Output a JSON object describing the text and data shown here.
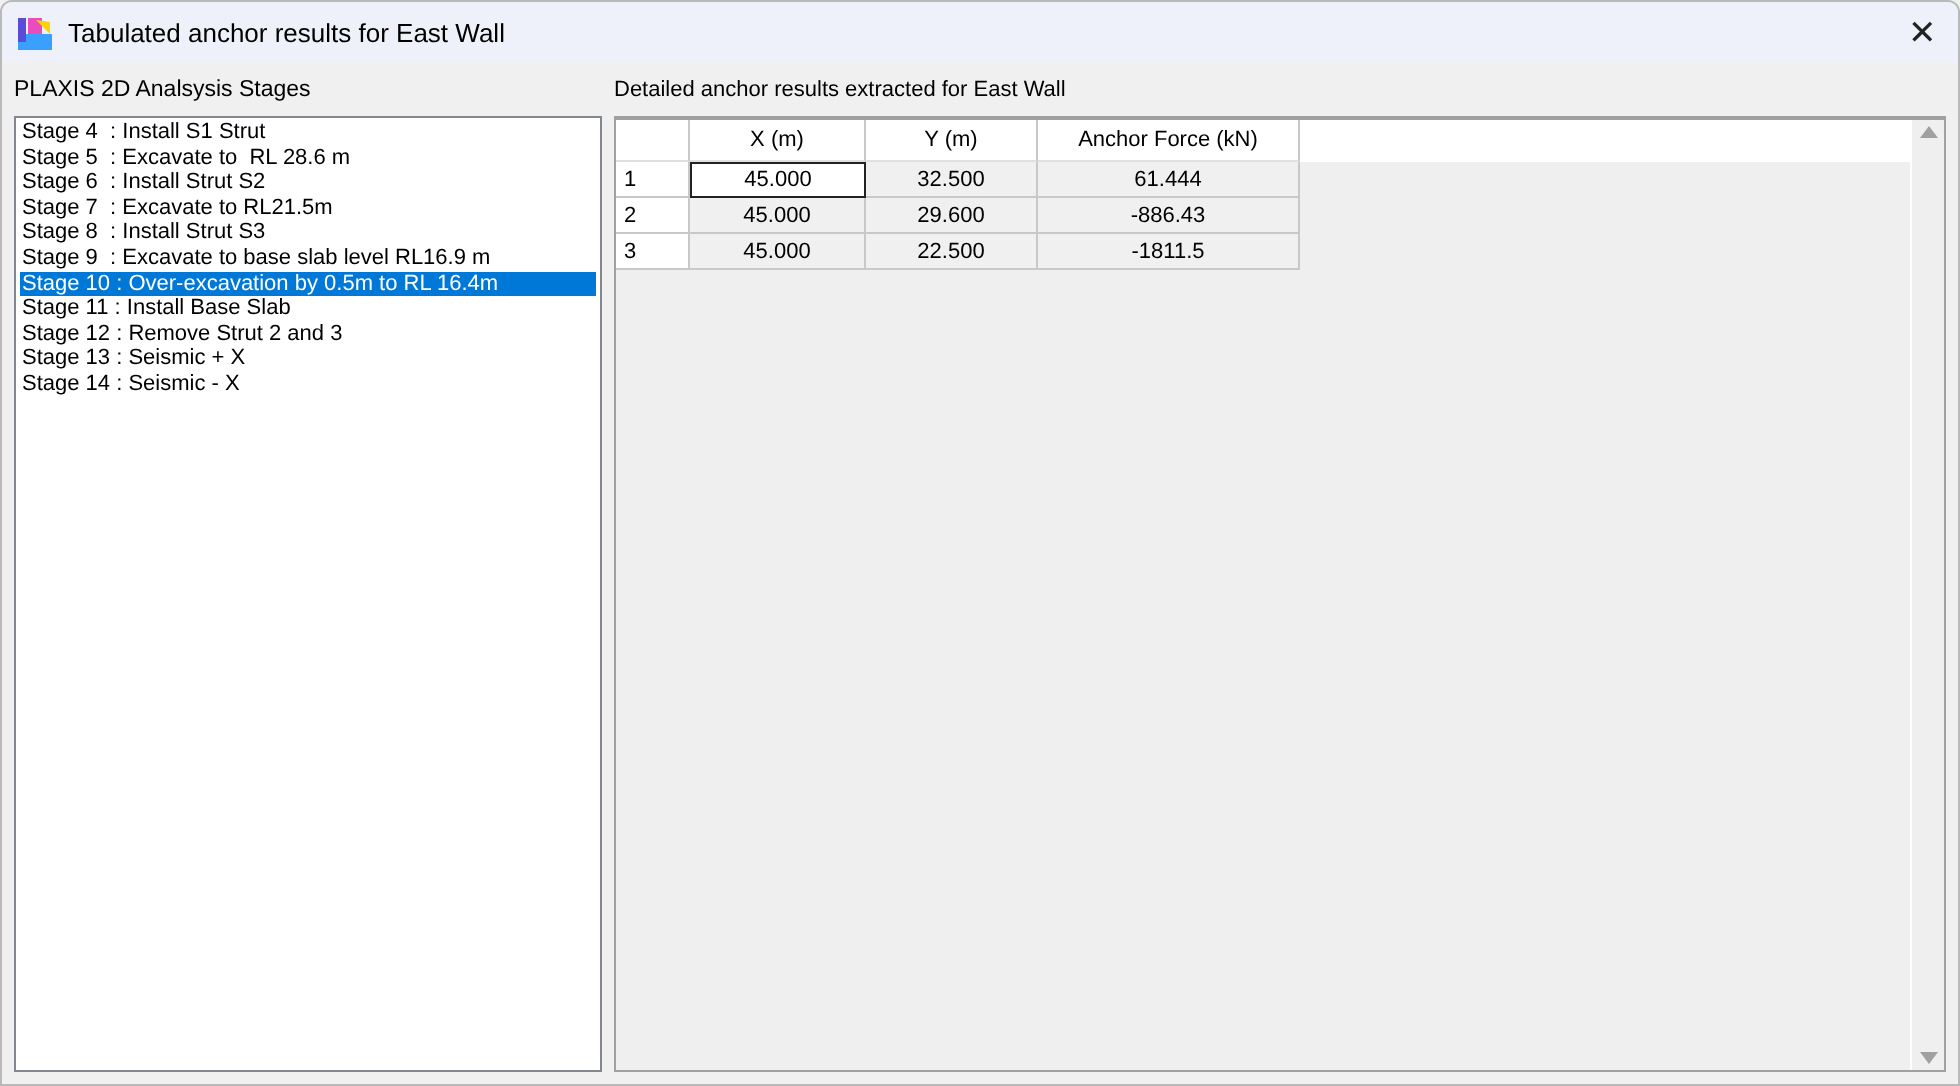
{
  "window": {
    "title": "Tabulated anchor results for East Wall",
    "close": "✕"
  },
  "stages": {
    "label": "PLAXIS 2D Analsysis Stages",
    "items": [
      {
        "text": "Stage 4  : Install S1 Strut",
        "selected": false
      },
      {
        "text": "Stage 5  : Excavate to  RL 28.6 m",
        "selected": false
      },
      {
        "text": "Stage 6  : Install Strut S2",
        "selected": false
      },
      {
        "text": "Stage 7  : Excavate to RL21.5m",
        "selected": false
      },
      {
        "text": "Stage 8  : Install Strut S3",
        "selected": false
      },
      {
        "text": "Stage 9  : Excavate to base slab level RL16.9 m",
        "selected": false
      },
      {
        "text": "Stage 10 : Over-excavation by 0.5m to RL 16.4m",
        "selected": true
      },
      {
        "text": "Stage 11 : Install Base Slab",
        "selected": false
      },
      {
        "text": "Stage 12 : Remove Strut 2 and 3",
        "selected": false
      },
      {
        "text": "Stage 13 : Seismic + X",
        "selected": false
      },
      {
        "text": "Stage 14 : Seismic - X",
        "selected": false
      }
    ]
  },
  "results": {
    "label": "Detailed anchor results extracted for East Wall",
    "table": {
      "columns": [
        "X (m)",
        "Y (m)",
        "Anchor Force (kN)"
      ],
      "rows": [
        {
          "header": "1",
          "cells": [
            {
              "text": "45.000",
              "focused": true
            },
            {
              "text": "32.500",
              "focused": false
            },
            {
              "text": "61.444",
              "focused": false
            }
          ]
        },
        {
          "header": "2",
          "cells": [
            {
              "text": "45.000",
              "focused": false
            },
            {
              "text": "29.600",
              "focused": false
            },
            {
              "text": "-886.43",
              "focused": false
            }
          ]
        },
        {
          "header": "3",
          "cells": [
            {
              "text": "45.000",
              "focused": false
            },
            {
              "text": "22.500",
              "focused": false
            },
            {
              "text": "-1811.5",
              "focused": false
            }
          ]
        }
      ]
    }
  }
}
